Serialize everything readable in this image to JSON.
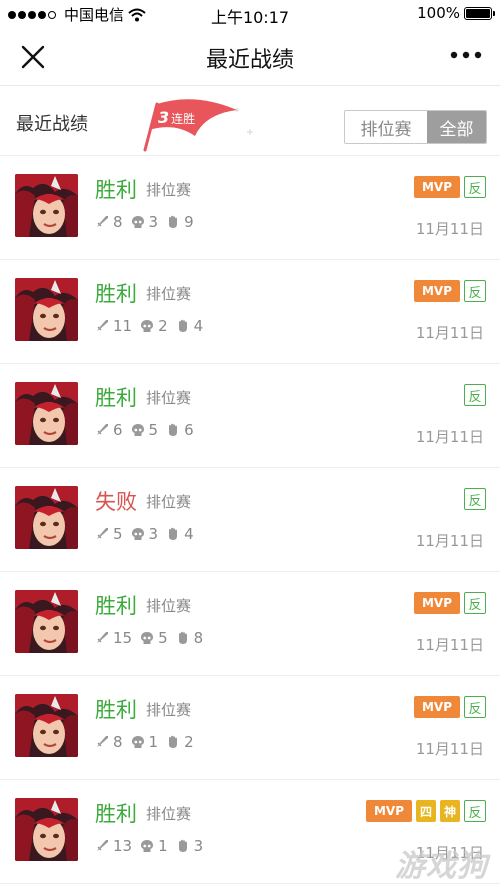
{
  "status_bar": {
    "carrier": "中国电信",
    "time": "上午10:17",
    "battery": "100%"
  },
  "nav": {
    "title": "最近战绩"
  },
  "subheader": {
    "title": "最近战绩",
    "streak_count": "3",
    "streak_label": "连胜",
    "tabs": [
      {
        "label": "排位赛",
        "active": false
      },
      {
        "label": "全部",
        "active": true
      }
    ]
  },
  "matches": [
    {
      "result": "胜利",
      "outcome": "win",
      "mode": "排位赛",
      "kills": "8",
      "deaths": "3",
      "assists": "9",
      "badges": [
        "MVP",
        "反"
      ],
      "date": "11月11日"
    },
    {
      "result": "胜利",
      "outcome": "win",
      "mode": "排位赛",
      "kills": "11",
      "deaths": "2",
      "assists": "4",
      "badges": [
        "MVP",
        "反"
      ],
      "date": "11月11日"
    },
    {
      "result": "胜利",
      "outcome": "win",
      "mode": "排位赛",
      "kills": "6",
      "deaths": "5",
      "assists": "6",
      "badges": [
        "反"
      ],
      "date": "11月11日"
    },
    {
      "result": "失败",
      "outcome": "lose",
      "mode": "排位赛",
      "kills": "5",
      "deaths": "3",
      "assists": "4",
      "badges": [
        "反"
      ],
      "date": "11月11日"
    },
    {
      "result": "胜利",
      "outcome": "win",
      "mode": "排位赛",
      "kills": "15",
      "deaths": "5",
      "assists": "8",
      "badges": [
        "MVP",
        "反"
      ],
      "date": "11月11日"
    },
    {
      "result": "胜利",
      "outcome": "win",
      "mode": "排位赛",
      "kills": "8",
      "deaths": "1",
      "assists": "2",
      "badges": [
        "MVP",
        "反"
      ],
      "date": "11月11日"
    },
    {
      "result": "胜利",
      "outcome": "win",
      "mode": "排位赛",
      "kills": "13",
      "deaths": "1",
      "assists": "3",
      "badges": [
        "MVP",
        "四",
        "神",
        "反"
      ],
      "date": "11月11日"
    }
  ],
  "colors": {
    "win": "#3bab3b",
    "lose": "#d9534f",
    "mvp": "#f0883a",
    "flag": "#e8555a",
    "segment_active": "#9e9e9e"
  },
  "icons": [
    "close-icon",
    "more-icon",
    "kill-icon",
    "death-icon",
    "assist-icon",
    "streak-flag-icon"
  ]
}
